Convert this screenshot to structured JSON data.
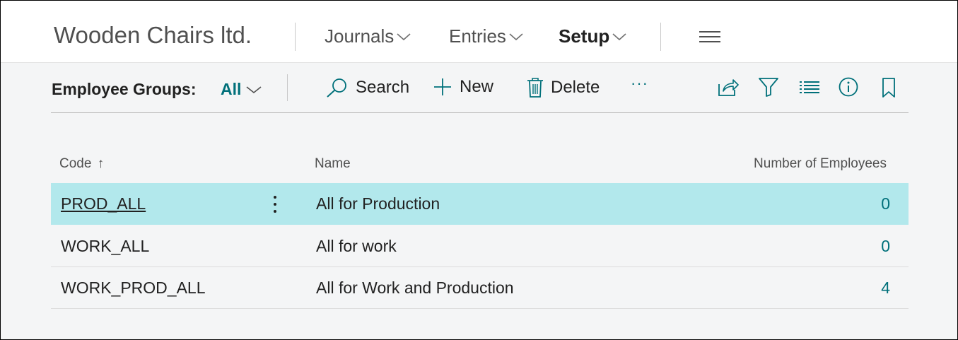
{
  "app": {
    "company": "Wooden Chairs ltd.",
    "nav": [
      {
        "label": "Journals",
        "active": false
      },
      {
        "label": "Entries",
        "active": false
      },
      {
        "label": "Setup",
        "active": true
      }
    ],
    "menu_icon": "hamburger-icon"
  },
  "page": {
    "title": "Employee Groups:",
    "filter": "All",
    "actions": {
      "search": "Search",
      "new": "New",
      "delete": "Delete",
      "more": "···"
    },
    "tool_icons": [
      "share-icon",
      "filter-icon",
      "list-view-icon",
      "info-icon",
      "bookmark-icon"
    ]
  },
  "table": {
    "columns": {
      "code": "Code",
      "sort_indicator": "↑",
      "name": "Name",
      "count": "Number of Employees"
    },
    "rows": [
      {
        "code": "PROD_ALL",
        "name": "All for Production",
        "count": "0"
      },
      {
        "code": "WORK_ALL",
        "name": "All for work",
        "count": "0"
      },
      {
        "code": "WORK_PROD_ALL",
        "name": "All for Work and Production",
        "count": "4"
      }
    ],
    "selected_row": 0
  },
  "colors": {
    "accent": "#00707a",
    "selected_row": "#b2e8ec"
  }
}
